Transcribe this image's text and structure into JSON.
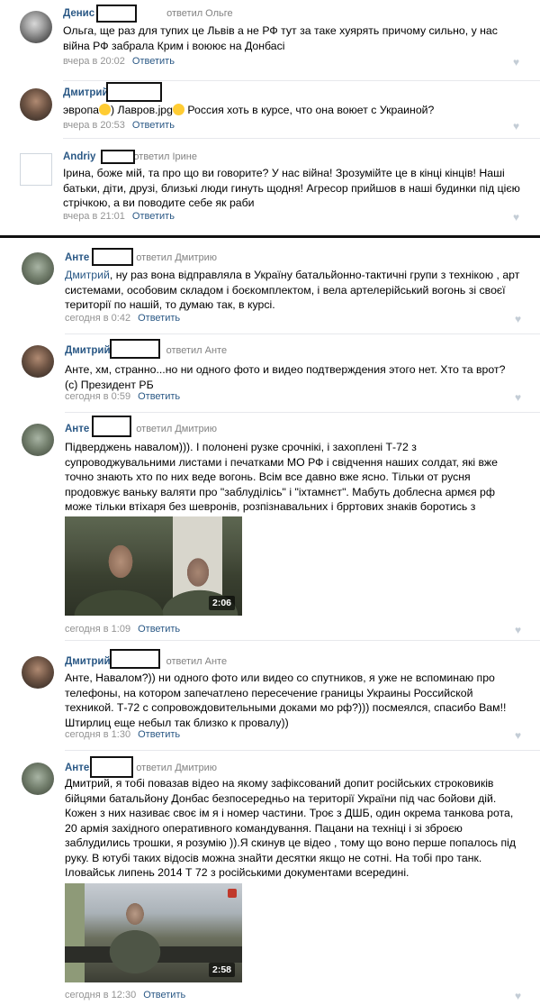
{
  "comments": [
    {
      "author": "Денис",
      "replied": "ответил Ольге",
      "text": "Ольга, ще раз для тупих це Львів а не РФ тут за таке хуярять причому сильно, у нас війна РФ забрала Крим і воюює на Донбасі",
      "time": "вчера в 20:02",
      "reply_label": "Ответить"
    },
    {
      "author": "Дмитрий",
      "replied": "",
      "text_a": "эвропа",
      "text_b": ") Лавров.jpg",
      "text_c": " Россия хоть в курсе, что она воюет с Украиной?",
      "time": "вчера в 20:53",
      "reply_label": "Ответить"
    },
    {
      "author": "Andriy",
      "replied": "ответил Ірине",
      "text": "Ірина, боже мій, та про що ви говорите? У нас війна! Зрозумійте це в кінці кінців! Наші батьки, діти, друзі, близькі люди гинуть щодня! Агресор прийшов в наші будинки під цією стрічкою, а ви поводите себе як раби",
      "time": "вчера в 21:01",
      "reply_label": "Ответить"
    },
    {
      "author": "Анте",
      "replied": "ответил Дмитрию",
      "ref": "Дмитрий",
      "text": ", ну раз вона відправляла в Україну батальйонно-тактичні групи з технікою , арт системами, особовим складом і боєкомплектом, і вела артелерійський вогонь зі своєї території по нашій, то думаю так, в курсі.",
      "time": "сегодня в 0:42",
      "reply_label": "Ответить"
    },
    {
      "author": "Дмитрий",
      "replied": "ответил Анте",
      "text": "Анте, хм, странно...но ни одного фото и видео подтверждения этого нет. Хто та врот? (с) Президент РБ",
      "time": "сегодня в 0:59",
      "reply_label": "Ответить"
    },
    {
      "author": "Анте",
      "replied": "ответил Дмитрию",
      "text": "Підверджень навалом))). І полонені рузке срочнікі, і захоплені Т-72 з супроводжувальними листами і печатками МО РФ і свідчення наших солдат, які вже точно знають хто по них веде вогонь. Всім все давно вже ясно. Тільки от русня продовжує ваньку валяти про \"заблуділісь\" і \"іхтамнєт\". Мабуть доблесна армєя рф може тільки втіхаря без шевронів, розпізнавальних і брртових знаків боротись з фашизмом)).",
      "video_duration": "2:06",
      "time": "сегодня в 1:09",
      "reply_label": "Ответить"
    },
    {
      "author": "Дмитрий",
      "replied": "ответил Анте",
      "text": "Анте, Навалом?)) ни одного фото или видео со спутников, я уже не вспоминаю про телефоны, на котором запечатлено пересечение границы Украины Российской техникой. Т-72 с сопровождовительными доками мо рф?))) посмеялся, спасибо Вам!! Штирлиц еще небыл так близко к провалу))",
      "time": "сегодня в 1:30",
      "reply_label": "Ответить"
    },
    {
      "author": "Анте",
      "replied": "ответил Дмитрию",
      "text": "Дмитрий, я тобі повазав відео на якому зафіксований допит російських строковиків бійцями батальйону Донбас безпосередньо на території України під час бойови дій. Кожен з них називає своє ім я і номер частини. Троє з ДШБ, один окрема танкова рота, 20 армія західного оперативного командування. Пацани на техніці і зі зброєю заблудились трошки, я розумію )).Я скинув це відео , тому що воно перше попалось під руку. В ютубі таких відосів можна знайти десятки якщо не сотні. На тобі про танк. Іловайськ липень 2014 Т 72 з російськими документами всередині.",
      "video_duration": "2:58",
      "time": "сегодня в 12:30",
      "reply_label": "Ответить"
    }
  ]
}
